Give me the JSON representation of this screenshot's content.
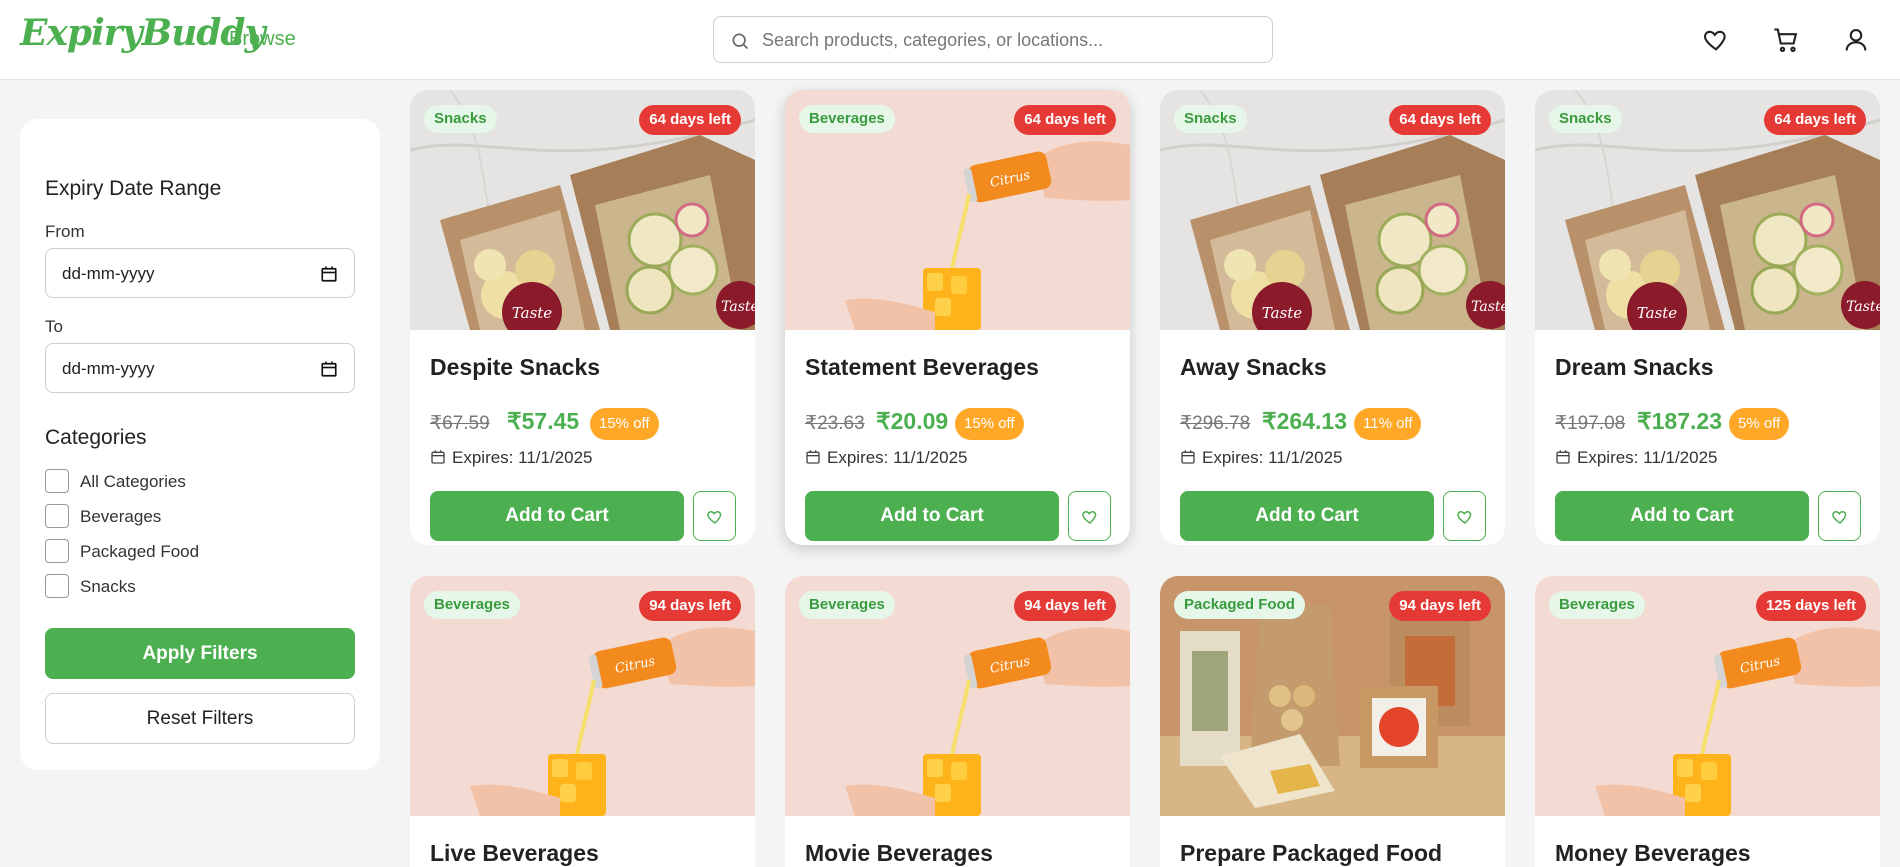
{
  "header": {
    "logo": "ExpiryBuddy",
    "browse": "Browse",
    "search_placeholder": "Search products, categories, or locations...",
    "icons": [
      "heart-icon",
      "cart-icon",
      "user-icon"
    ]
  },
  "sidebar": {
    "expiry_title": "Expiry Date Range",
    "from_label": "From",
    "from_value": "dd-mm-yyyy",
    "to_label": "To",
    "to_value": "dd-mm-yyyy",
    "categories_title": "Categories",
    "categories": [
      {
        "label": "All Categories",
        "checked": false
      },
      {
        "label": "Beverages",
        "checked": false
      },
      {
        "label": "Packaged Food",
        "checked": false
      },
      {
        "label": "Snacks",
        "checked": false
      }
    ],
    "apply_label": "Apply Filters",
    "reset_label": "Reset Filters"
  },
  "products": [
    {
      "category": "Snacks",
      "days": "64 days left",
      "name": "Despite Snacks",
      "old_price": "₹67.59",
      "new_price": "₹57.45",
      "discount": "15% off",
      "expires": "Expires: 11/1/2025",
      "add_label": "Add to Cart",
      "image": "snacks"
    },
    {
      "category": "Beverages",
      "days": "64 days left",
      "name": "Statement Beverages",
      "old_price": "₹23.63",
      "new_price": "₹20.09",
      "discount": "15% off",
      "expires": "Expires: 11/1/2025",
      "add_label": "Add to Cart",
      "image": "beverage"
    },
    {
      "category": "Snacks",
      "days": "64 days left",
      "name": "Away Snacks",
      "old_price": "₹296.78",
      "new_price": "₹264.13",
      "discount": "11% off",
      "expires": "Expires: 11/1/2025",
      "add_label": "Add to Cart",
      "image": "snacks"
    },
    {
      "category": "Snacks",
      "days": "64 days left",
      "name": "Dream Snacks",
      "old_price": "₹197.08",
      "new_price": "₹187.23",
      "discount": "5% off",
      "expires": "Expires: 11/1/2025",
      "add_label": "Add to Cart",
      "image": "snacks"
    },
    {
      "category": "Beverages",
      "days": "94 days left",
      "name": "Live Beverages",
      "image": "beverage"
    },
    {
      "category": "Beverages",
      "days": "94 days left",
      "name": "Movie Beverages",
      "image": "beverage"
    },
    {
      "category": "Packaged Food",
      "days": "94 days left",
      "name": "Prepare Packaged Food",
      "image": "packaged"
    },
    {
      "category": "Beverages",
      "days": "125 days left",
      "name": "Money Beverages",
      "image": "beverage"
    }
  ],
  "colors": {
    "accent": "#4caf50",
    "danger": "#e53935",
    "discount": "#ffa726",
    "badge_bg": "#e6f7ea"
  }
}
